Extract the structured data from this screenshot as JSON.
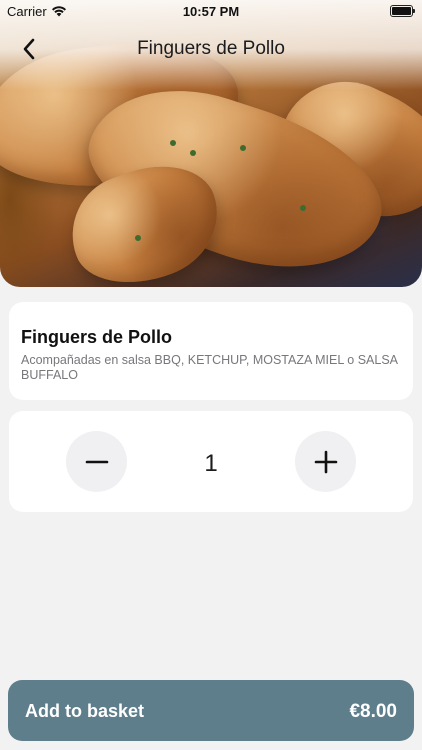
{
  "status_bar": {
    "carrier": "Carrier",
    "time": "10:57 PM"
  },
  "nav": {
    "title": "Finguers de Pollo",
    "back_icon": "chevron-left-icon"
  },
  "product": {
    "name": "Finguers de Pollo",
    "description": "Acompañadas en salsa BBQ, KETCHUP, MOSTAZA MIEL o SALSA BUFFALO"
  },
  "quantity": {
    "value": "1",
    "decrement_icon": "minus-icon",
    "increment_icon": "plus-icon"
  },
  "basket": {
    "label": "Add to basket",
    "price": "€8.00",
    "color": "#5f7e8c"
  },
  "colors": {
    "background": "#f2f2f3",
    "card": "#ffffff",
    "stepper_button": "#f0f0f2"
  }
}
